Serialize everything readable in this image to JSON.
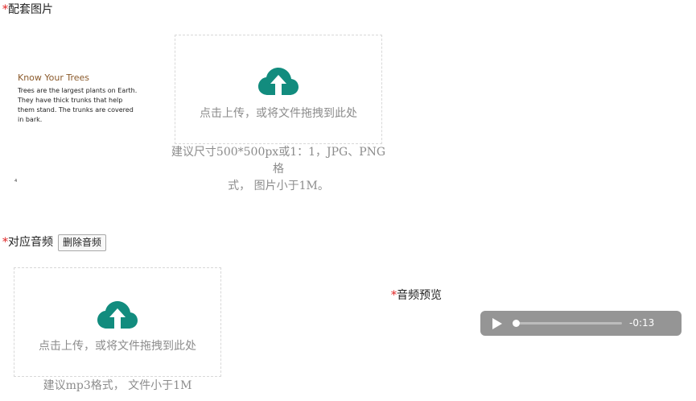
{
  "image_section": {
    "required_mark": "*",
    "label": "配套图片",
    "preview": {
      "title": "Know Your Trees",
      "body": "Trees are the largest plants on Earth.\nThey have thick trunks that help\nthem stand. The trunks are covered\nin bark.",
      "page_number": "4"
    },
    "upload": {
      "icon": "cloud-upload-icon",
      "text": "点击上传，或将文件拖拽到此处"
    },
    "hint_line1": "建议尺寸500*500px或1：1，JPG、PNG格",
    "hint_line2": "式， 图片小于1M。"
  },
  "audio_section": {
    "required_mark": "*",
    "label": "对应音频",
    "delete_button": "删除音频",
    "upload": {
      "icon": "cloud-upload-icon",
      "text": "点击上传，或将文件拖拽到此处"
    },
    "hint": "建议mp3格式， 文件小于1M"
  },
  "audio_preview": {
    "required_mark": "*",
    "label": "音频预览",
    "player": {
      "play_icon": "play-icon",
      "time": "-0:13",
      "progress": 0
    }
  },
  "colors": {
    "required": "#e02020",
    "accent": "#128c7e",
    "muted_text": "#8c8c8c",
    "player_bg": "#959595"
  }
}
